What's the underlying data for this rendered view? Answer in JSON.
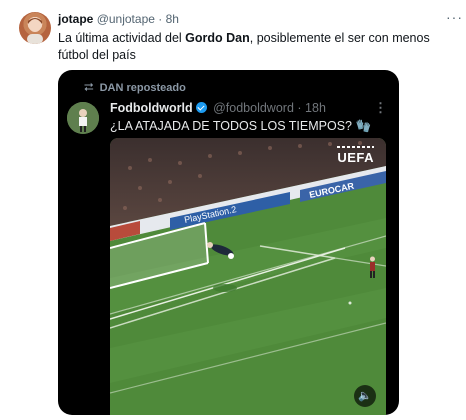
{
  "post": {
    "author_name": "jotape",
    "author_handle": "@unjotape",
    "separator": "·",
    "time": "8h",
    "more_label": "···",
    "text_before": "La última actividad del ",
    "text_bold": "Gordo Dan",
    "text_after": ", posiblemente el ser con menos fútbol del país"
  },
  "embed": {
    "repost_icon": "⮂",
    "repost_label": "DAN reposteado",
    "author_name": "Fodboldworld",
    "author_handle": "@fodboldword",
    "separator": "·",
    "time": "18h",
    "more_label": "⋮",
    "text": "¿LA ATAJADA DE TODOS LOS TIEMPOS? 🧤",
    "video": {
      "broadcaster": "UEFA",
      "board_1": "PlayStation.2",
      "board_2": "EUROCAR",
      "mute_icon": "🔈"
    }
  },
  "colors": {
    "accent": "#1d9bf0",
    "pitch": "#4f8a3a",
    "embed_bg": "#000000"
  },
  "icons": [
    "repost-icon",
    "verified-icon",
    "more-icon",
    "mute-icon"
  ]
}
